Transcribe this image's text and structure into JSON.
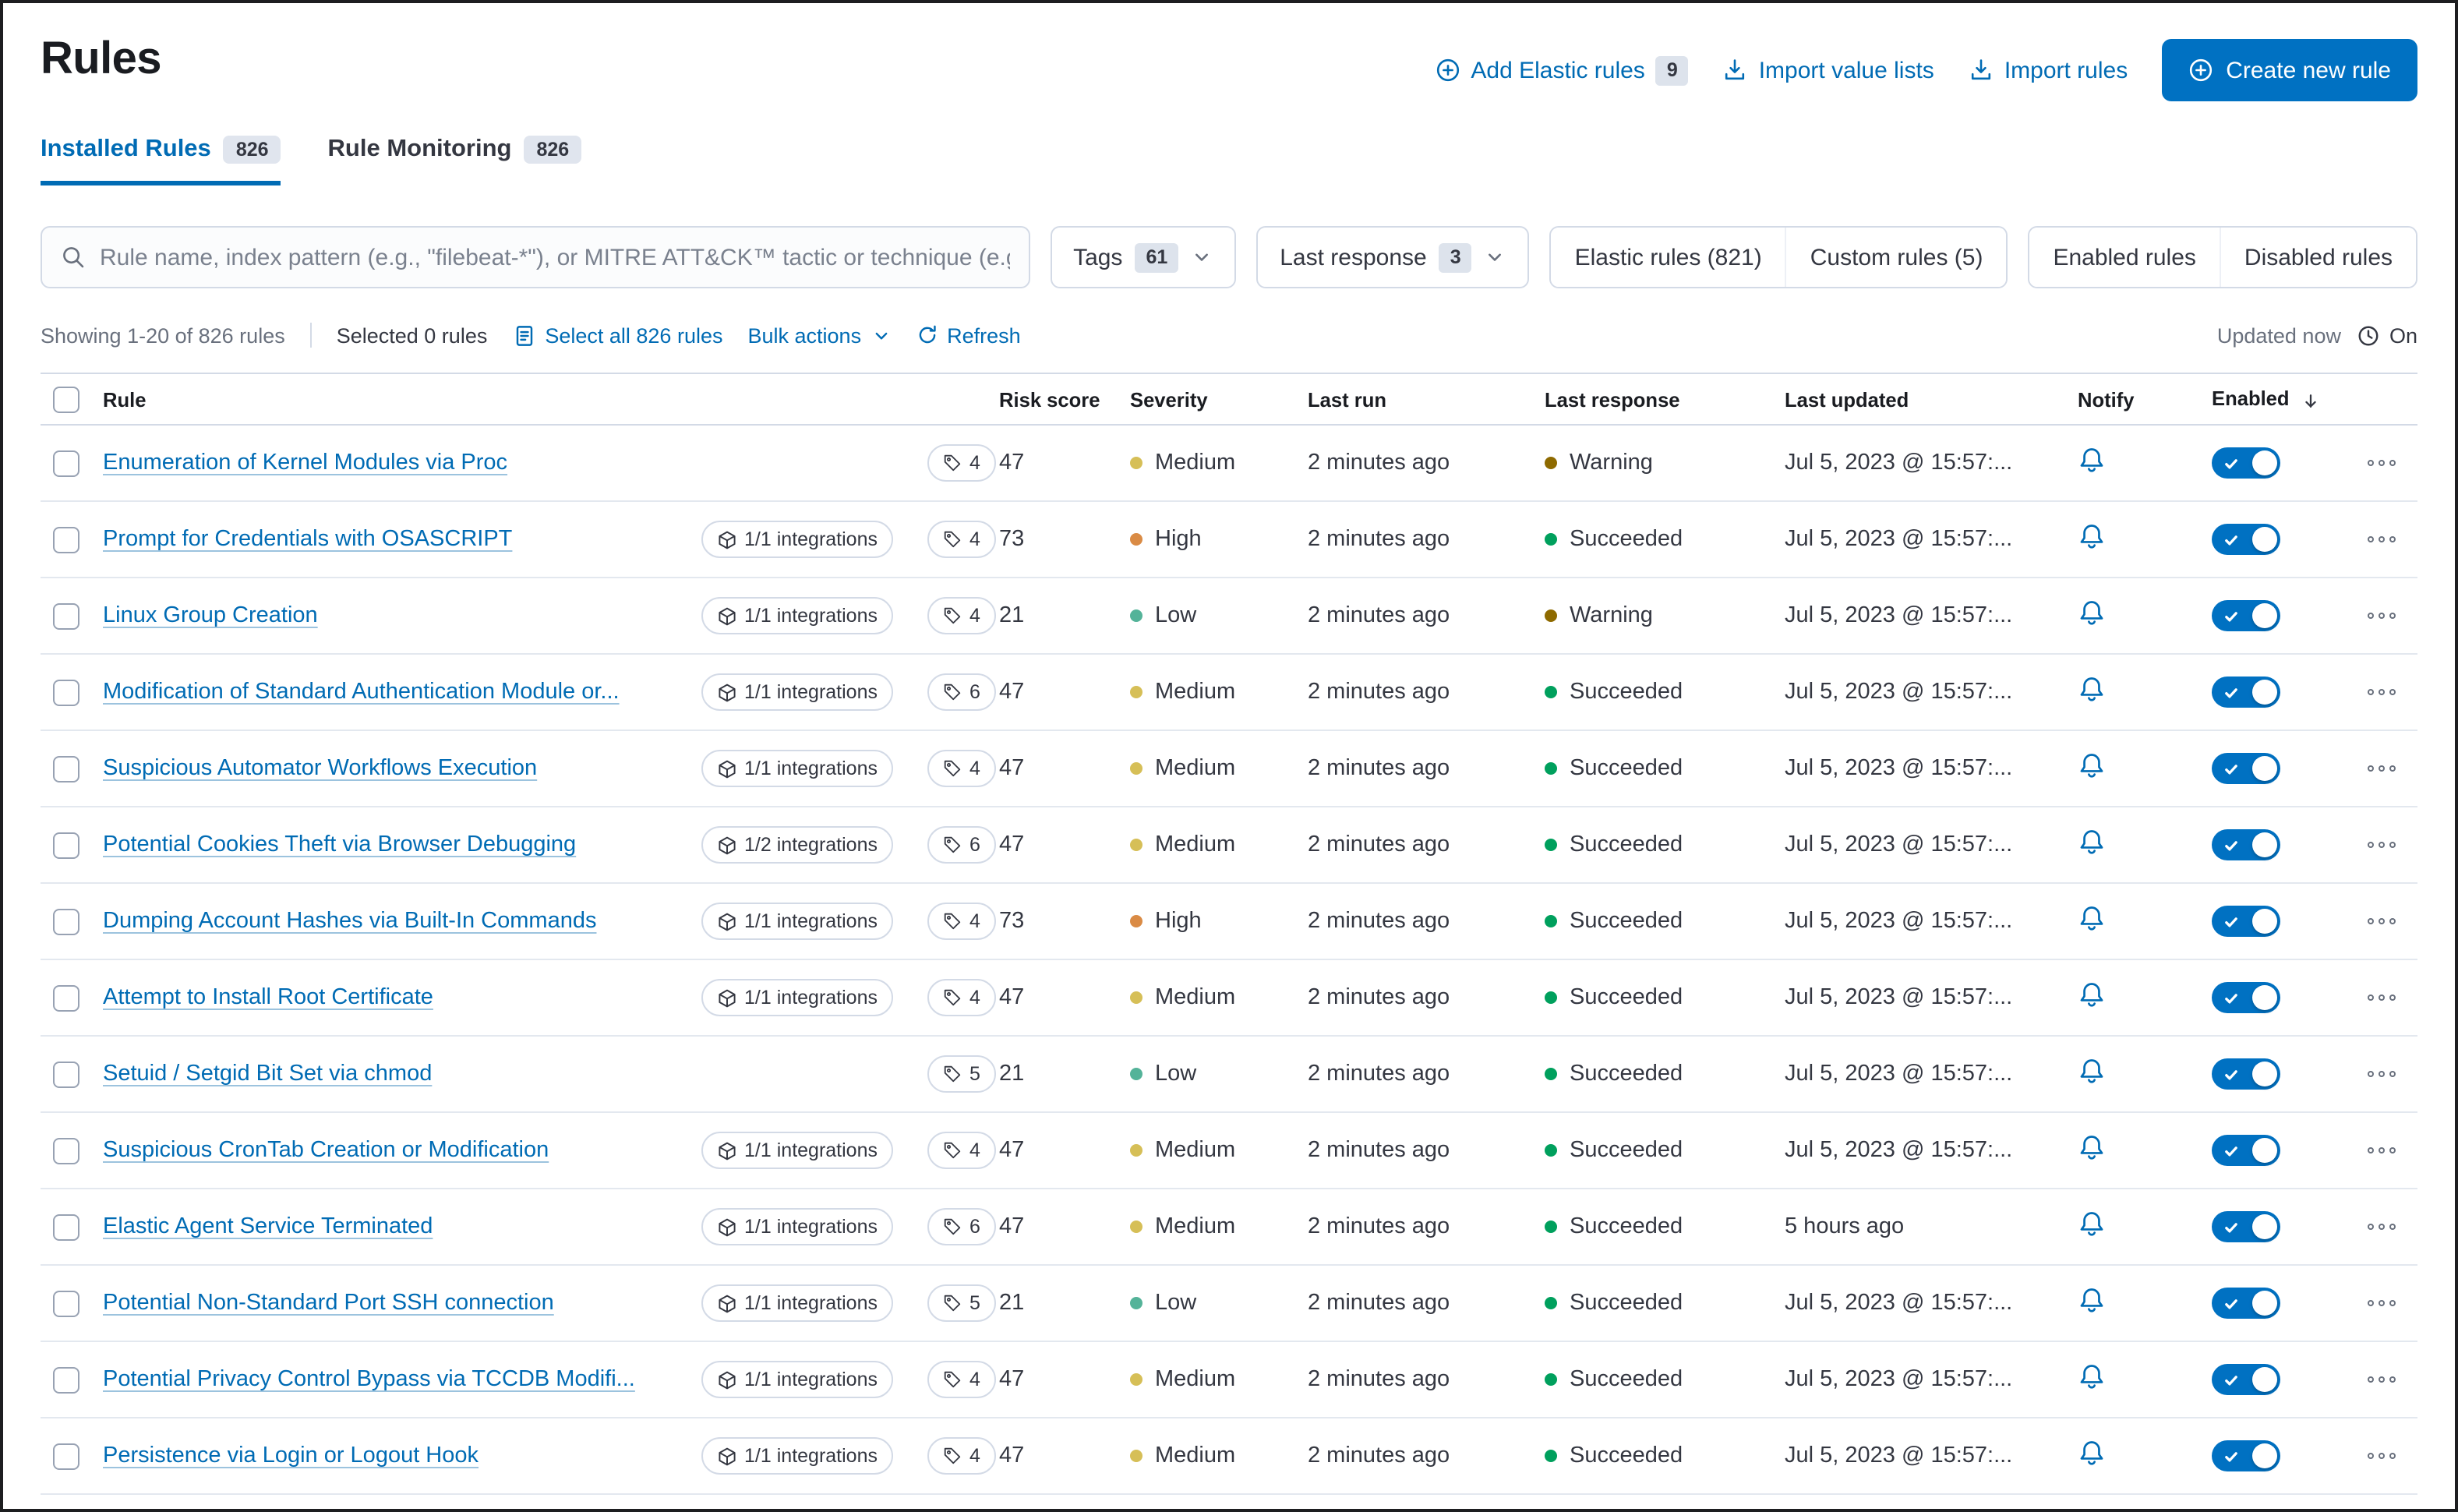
{
  "page": {
    "title": "Rules",
    "header_actions": {
      "add_elastic_rules": "Add Elastic rules",
      "add_elastic_rules_count": "9",
      "import_value_lists": "Import value lists",
      "import_rules": "Import rules",
      "create_new_rule": "Create new rule"
    },
    "tabs": [
      {
        "label": "Installed Rules",
        "count": "826"
      },
      {
        "label": "Rule Monitoring",
        "count": "826"
      }
    ]
  },
  "filters": {
    "search_placeholder": "Rule name, index pattern (e.g., \"filebeat-*\"), or MITRE ATT&CK™ tactic or technique (e.g., \"Defense Ev",
    "tags_label": "Tags",
    "tags_count": "61",
    "last_response_label": "Last response",
    "last_response_count": "3",
    "elastic_rules": "Elastic rules (821)",
    "custom_rules": "Custom rules (5)",
    "enabled_rules": "Enabled rules",
    "disabled_rules": "Disabled rules"
  },
  "utility": {
    "showing": "Showing 1-20 of 826 rules",
    "selected": "Selected 0 rules",
    "select_all": "Select all 826 rules",
    "bulk_actions": "Bulk actions",
    "refresh": "Refresh",
    "updated": "Updated now",
    "auto_refresh_state": "On"
  },
  "table": {
    "headers": [
      "Rule",
      "Risk score",
      "Severity",
      "Last run",
      "Last response",
      "Last updated",
      "Notify",
      "Enabled"
    ],
    "sorted_by": "Enabled",
    "rows": [
      {
        "name": "Enumeration of Kernel Modules via Proc",
        "integrations": null,
        "tags": "4",
        "risk_score": "47",
        "severity": "Medium",
        "last_run": "2 minutes ago",
        "last_response": "Warning",
        "last_updated": "Jul 5, 2023 @ 15:57:...",
        "enabled": true
      },
      {
        "name": "Prompt for Credentials with OSASCRIPT",
        "integrations": "1/1 integrations",
        "tags": "4",
        "risk_score": "73",
        "severity": "High",
        "last_run": "2 minutes ago",
        "last_response": "Succeeded",
        "last_updated": "Jul 5, 2023 @ 15:57:...",
        "enabled": true
      },
      {
        "name": "Linux Group Creation",
        "integrations": "1/1 integrations",
        "tags": "4",
        "risk_score": "21",
        "severity": "Low",
        "last_run": "2 minutes ago",
        "last_response": "Warning",
        "last_updated": "Jul 5, 2023 @ 15:57:...",
        "enabled": true
      },
      {
        "name": "Modification of Standard Authentication Module or...",
        "integrations": "1/1 integrations",
        "tags": "6",
        "risk_score": "47",
        "severity": "Medium",
        "last_run": "2 minutes ago",
        "last_response": "Succeeded",
        "last_updated": "Jul 5, 2023 @ 15:57:...",
        "enabled": true
      },
      {
        "name": "Suspicious Automator Workflows Execution",
        "integrations": "1/1 integrations",
        "tags": "4",
        "risk_score": "47",
        "severity": "Medium",
        "last_run": "2 minutes ago",
        "last_response": "Succeeded",
        "last_updated": "Jul 5, 2023 @ 15:57:...",
        "enabled": true
      },
      {
        "name": "Potential Cookies Theft via Browser Debugging",
        "integrations": "1/2 integrations",
        "tags": "6",
        "risk_score": "47",
        "severity": "Medium",
        "last_run": "2 minutes ago",
        "last_response": "Succeeded",
        "last_updated": "Jul 5, 2023 @ 15:57:...",
        "enabled": true
      },
      {
        "name": "Dumping Account Hashes via Built-In Commands",
        "integrations": "1/1 integrations",
        "tags": "4",
        "risk_score": "73",
        "severity": "High",
        "last_run": "2 minutes ago",
        "last_response": "Succeeded",
        "last_updated": "Jul 5, 2023 @ 15:57:...",
        "enabled": true
      },
      {
        "name": "Attempt to Install Root Certificate",
        "integrations": "1/1 integrations",
        "tags": "4",
        "risk_score": "47",
        "severity": "Medium",
        "last_run": "2 minutes ago",
        "last_response": "Succeeded",
        "last_updated": "Jul 5, 2023 @ 15:57:...",
        "enabled": true
      },
      {
        "name": "Setuid / Setgid Bit Set via chmod",
        "integrations": null,
        "tags": "5",
        "risk_score": "21",
        "severity": "Low",
        "last_run": "2 minutes ago",
        "last_response": "Succeeded",
        "last_updated": "Jul 5, 2023 @ 15:57:...",
        "enabled": true
      },
      {
        "name": "Suspicious CronTab Creation or Modification",
        "integrations": "1/1 integrations",
        "tags": "4",
        "risk_score": "47",
        "severity": "Medium",
        "last_run": "2 minutes ago",
        "last_response": "Succeeded",
        "last_updated": "Jul 5, 2023 @ 15:57:...",
        "enabled": true
      },
      {
        "name": "Elastic Agent Service Terminated",
        "integrations": "1/1 integrations",
        "tags": "6",
        "risk_score": "47",
        "severity": "Medium",
        "last_run": "2 minutes ago",
        "last_response": "Succeeded",
        "last_updated": "5 hours ago",
        "enabled": true
      },
      {
        "name": "Potential Non-Standard Port SSH connection",
        "integrations": "1/1 integrations",
        "tags": "5",
        "risk_score": "21",
        "severity": "Low",
        "last_run": "2 minutes ago",
        "last_response": "Succeeded",
        "last_updated": "Jul 5, 2023 @ 15:57:...",
        "enabled": true
      },
      {
        "name": "Potential Privacy Control Bypass via TCCDB Modifi...",
        "integrations": "1/1 integrations",
        "tags": "4",
        "risk_score": "47",
        "severity": "Medium",
        "last_run": "2 minutes ago",
        "last_response": "Succeeded",
        "last_updated": "Jul 5, 2023 @ 15:57:...",
        "enabled": true
      },
      {
        "name": "Persistence via Login or Logout Hook",
        "integrations": "1/1 integrations",
        "tags": "4",
        "risk_score": "47",
        "severity": "Medium",
        "last_run": "2 minutes ago",
        "last_response": "Succeeded",
        "last_updated": "Jul 5, 2023 @ 15:57:...",
        "enabled": true
      }
    ]
  },
  "icons": {
    "add": "plus-in-circle-icon",
    "import": "import-icon",
    "search": "search-icon",
    "tags_badge": "tag-icon",
    "integrations_badge": "package-icon",
    "notify": "bell-icon",
    "actions": "ellipsis-icon"
  },
  "colors": {
    "primary_button": "#0071C2",
    "link": "#006BB4",
    "toggle_on": "#0071C2",
    "severity": {
      "Low": "#54B399",
      "Medium": "#D6BF57",
      "High": "#DA8B45"
    },
    "response": {
      "Succeeded": "#00A05D",
      "Warning": "#8E6A00"
    }
  }
}
